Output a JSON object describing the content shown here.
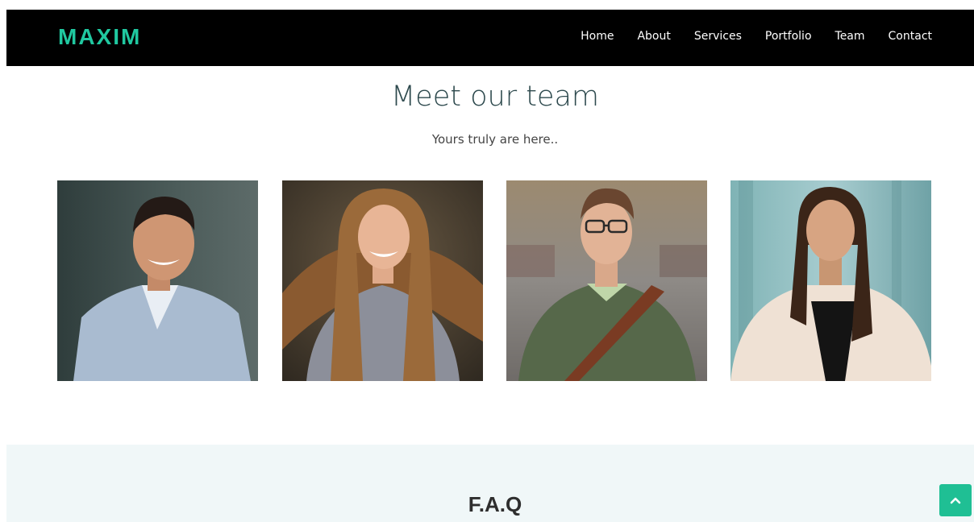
{
  "header": {
    "brand": "MAXIM",
    "brand_color": "#20c8a0",
    "nav": [
      {
        "label": "Home"
      },
      {
        "label": "About"
      },
      {
        "label": "Services"
      },
      {
        "label": "Portfolio"
      },
      {
        "label": "Team"
      },
      {
        "label": "Contact"
      }
    ]
  },
  "team": {
    "title": "Meet our team",
    "subtitle": "Yours truly are here..",
    "members": [
      {
        "photo": "team-member-photo-1"
      },
      {
        "photo": "team-member-photo-2"
      },
      {
        "photo": "team-member-photo-3"
      },
      {
        "photo": "team-member-photo-4"
      }
    ]
  },
  "faq": {
    "title": "F.A.Q"
  },
  "back_to_top": {
    "icon": "chevron-up-icon",
    "color": "#1fbf94"
  }
}
